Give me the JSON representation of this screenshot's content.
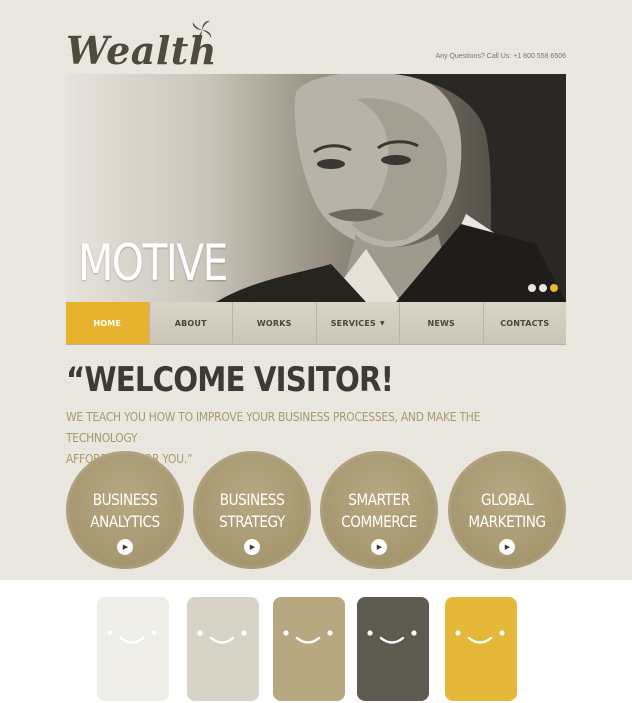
{
  "logo": {
    "text": "Wealth",
    "icon": "swirl-icon"
  },
  "header": {
    "contact": "Any Questions?  Call Us: +1 800 558 6506"
  },
  "hero": {
    "title": "MOTIVE",
    "slides": 3,
    "active_slide": 3
  },
  "nav": [
    {
      "label": "HOME",
      "active": true
    },
    {
      "label": "ABOUT"
    },
    {
      "label": "WORKS"
    },
    {
      "label": "SERVICES",
      "dropdown": true
    },
    {
      "label": "NEWS"
    },
    {
      "label": "CONTACTS"
    }
  ],
  "welcome": {
    "title": "“WELCOME  VISITOR!",
    "subtitle_line1": "WE TEACH YOU HOW TO IMPROVE YOUR BUSINESS PROCESSES, AND MAKE THE TECHNOLOGY",
    "subtitle_line2": "AFFORDABLE FOR YOU.”"
  },
  "services": [
    {
      "line1": "BUSINESS",
      "line2": "ANALYTICS"
    },
    {
      "line1": "BUSINESS",
      "line2": "STRATEGY"
    },
    {
      "line1": "SMARTER",
      "line2": "COMMERCE"
    },
    {
      "line1": "GLOBAL",
      "line2": "MARKETING"
    }
  ],
  "palette": {
    "colors": [
      "#efede8",
      "#d8d3c7",
      "#b7a882",
      "#5d5a50",
      "#e6b83a"
    ],
    "icon": "smiley-face-icon"
  },
  "colors": {
    "accent": "#e7b32e",
    "circle": "#aa9b73",
    "text_dark": "#3d3a33"
  }
}
